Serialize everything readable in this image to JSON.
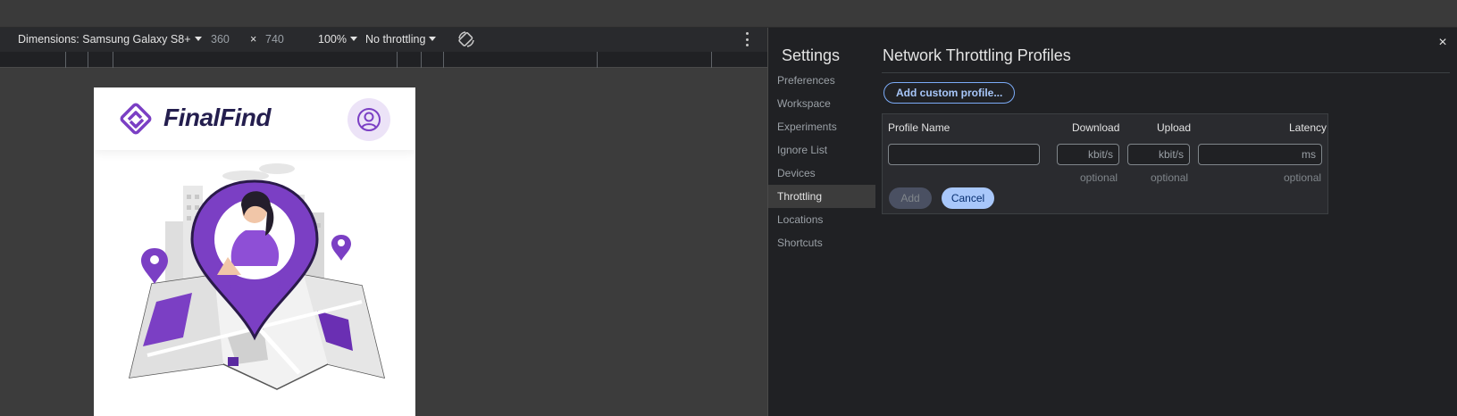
{
  "device_toolbar": {
    "dimensions_label": "Dimensions: Samsung Galaxy S8+",
    "width": "360",
    "times": "×",
    "height": "740",
    "zoom": "100%",
    "throttling": "No throttling"
  },
  "app": {
    "logo_text": "FinalFind",
    "brand_color": "#7b3fc4"
  },
  "settings": {
    "title": "Settings",
    "nav": [
      {
        "label": "Preferences"
      },
      {
        "label": "Workspace"
      },
      {
        "label": "Experiments"
      },
      {
        "label": "Ignore List"
      },
      {
        "label": "Devices"
      },
      {
        "label": "Throttling",
        "active": true
      },
      {
        "label": "Locations"
      },
      {
        "label": "Shortcuts"
      }
    ],
    "close_icon": "×"
  },
  "throttling": {
    "title": "Network Throttling Profiles",
    "add_button": "Add custom profile...",
    "columns": {
      "profile_name": "Profile Name",
      "download": "Download",
      "upload": "Upload",
      "latency": "Latency"
    },
    "fields": {
      "profile_name_value": "",
      "download_unit": "kbit/s",
      "upload_unit": "kbit/s",
      "latency_unit": "ms"
    },
    "optional": "optional",
    "add": "Add",
    "cancel": "Cancel"
  },
  "colors": {
    "accent": "#a8c7fa",
    "panel_bg": "#202124",
    "brand_purple": "#7b3fc4"
  }
}
